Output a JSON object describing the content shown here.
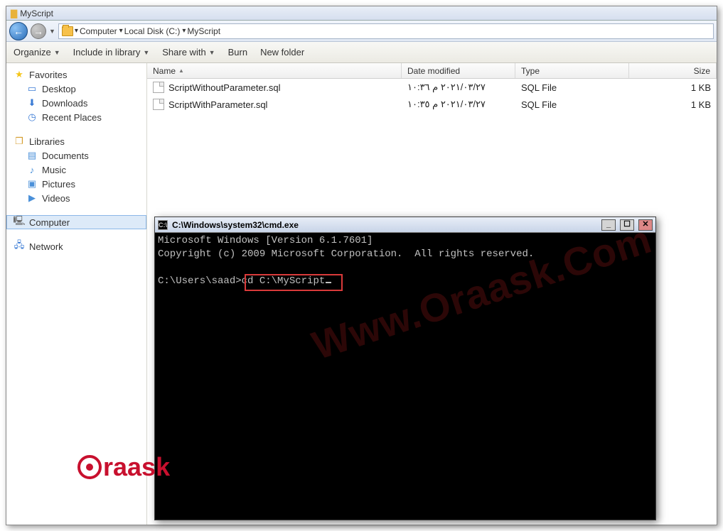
{
  "explorer": {
    "window_title": "MyScript",
    "breadcrumb": {
      "segments": [
        "Computer",
        "Local Disk (C:)",
        "MyScript"
      ]
    },
    "toolbar": {
      "organize": "Organize",
      "include": "Include in library",
      "share": "Share with",
      "burn": "Burn",
      "newfolder": "New folder"
    },
    "sidebar": {
      "favorites": {
        "label": "Favorites",
        "items": [
          "Desktop",
          "Downloads",
          "Recent Places"
        ]
      },
      "libraries": {
        "label": "Libraries",
        "items": [
          "Documents",
          "Music",
          "Pictures",
          "Videos"
        ]
      },
      "computer": {
        "label": "Computer"
      },
      "network": {
        "label": "Network"
      }
    },
    "columns": {
      "name": "Name",
      "date": "Date modified",
      "type": "Type",
      "size": "Size"
    },
    "files": [
      {
        "name": "ScriptWithoutParameter.sql",
        "date": "٢٠٢١/٠٣/٢٧ م ١٠:٣٦",
        "type": "SQL File",
        "size": "1 KB"
      },
      {
        "name": "ScriptWithParameter.sql",
        "date": "٢٠٢١/٠٣/٢٧ م ١٠:٣٥",
        "type": "SQL File",
        "size": "1 KB"
      }
    ]
  },
  "cmd": {
    "title": "C:\\Windows\\system32\\cmd.exe",
    "line1": "Microsoft Windows [Version 6.1.7601]",
    "line2": "Copyright (c) 2009 Microsoft Corporation.  All rights reserved.",
    "prompt": "C:\\Users\\saad>",
    "command": "cd C:\\MyScript"
  },
  "watermark": {
    "diagonal": "Www.Oraask.Com",
    "logo_text": "raask"
  }
}
